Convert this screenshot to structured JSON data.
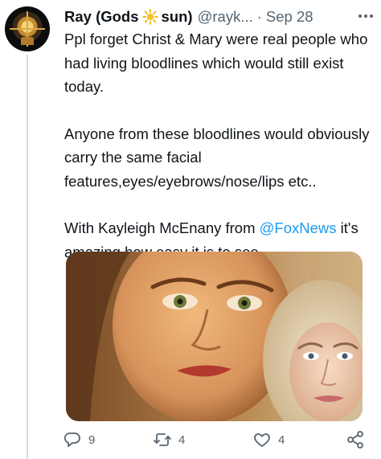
{
  "author": {
    "name_part1": "Ray (Gods",
    "name_part2": "sun)",
    "name_icon": "sun-icon",
    "handle": "@rayk...",
    "separator": "·",
    "date": "Sep 28"
  },
  "tweet": {
    "paragraph1": "Ppl forget Christ & Mary were real people who had living bloodlines which would still exist today.",
    "paragraph2": "Anyone from these bloodlines would obviously carry the same facial features,eyes/eyebrows/nose/lips etc..",
    "paragraph3_before": "With Kayleigh McEnany from ",
    "mention": "@FoxNews",
    "paragraph3_after": " it's amazing how easy it is to see."
  },
  "actions": {
    "reply_icon": "reply-icon",
    "reply_count": "9",
    "retweet_icon": "retweet-icon",
    "retweet_count": "4",
    "like_icon": "heart-icon",
    "like_count": "4",
    "share_icon": "share-icon"
  },
  "colors": {
    "link": "#1d9bf0",
    "secondary_text": "#536471",
    "primary_text": "#0f1419"
  }
}
